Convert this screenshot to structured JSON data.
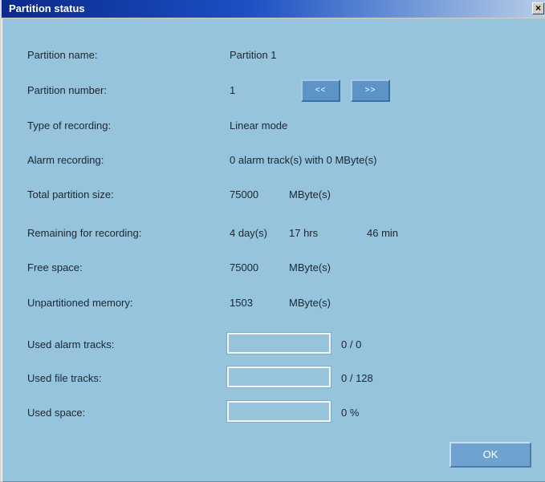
{
  "window": {
    "title": "Partition status",
    "close_label": "×"
  },
  "rows": {
    "partition_name": {
      "label": "Partition name:",
      "value": "Partition 1"
    },
    "partition_number": {
      "label": "Partition number:",
      "value": "1",
      "prev_label": "<<",
      "next_label": ">>"
    },
    "type_of_recording": {
      "label": "Type of recording:",
      "value": "Linear mode"
    },
    "alarm_recording": {
      "label": "Alarm recording:",
      "value": "0 alarm track(s) with 0 MByte(s)"
    },
    "total_partition_size": {
      "label": "Total partition size:",
      "value": "75000",
      "unit": "MByte(s)"
    },
    "remaining": {
      "label": "Remaining for recording:",
      "days": "4 day(s)",
      "hours": "17 hrs",
      "minutes": "46 min"
    },
    "free_space": {
      "label": "Free space:",
      "value": "75000",
      "unit": "MByte(s)"
    },
    "unpartitioned": {
      "label": "Unpartitioned memory:",
      "value": "1503",
      "unit": "MByte(s)"
    }
  },
  "usage": {
    "alarm_tracks": {
      "label": "Used alarm tracks:",
      "text": "0 / 0",
      "fraction": 0
    },
    "file_tracks": {
      "label": "Used file tracks:",
      "text": "0 / 128",
      "fraction": 0
    },
    "space": {
      "label": "Used space:",
      "text": "0 %",
      "fraction": 0
    }
  },
  "buttons": {
    "ok_label": "OK"
  },
  "colors": {
    "window_bg": "#96c4dc",
    "title_bar_start": "#0a2a8c",
    "button_bg": "#5c94c8",
    "text": "#1a2632"
  }
}
